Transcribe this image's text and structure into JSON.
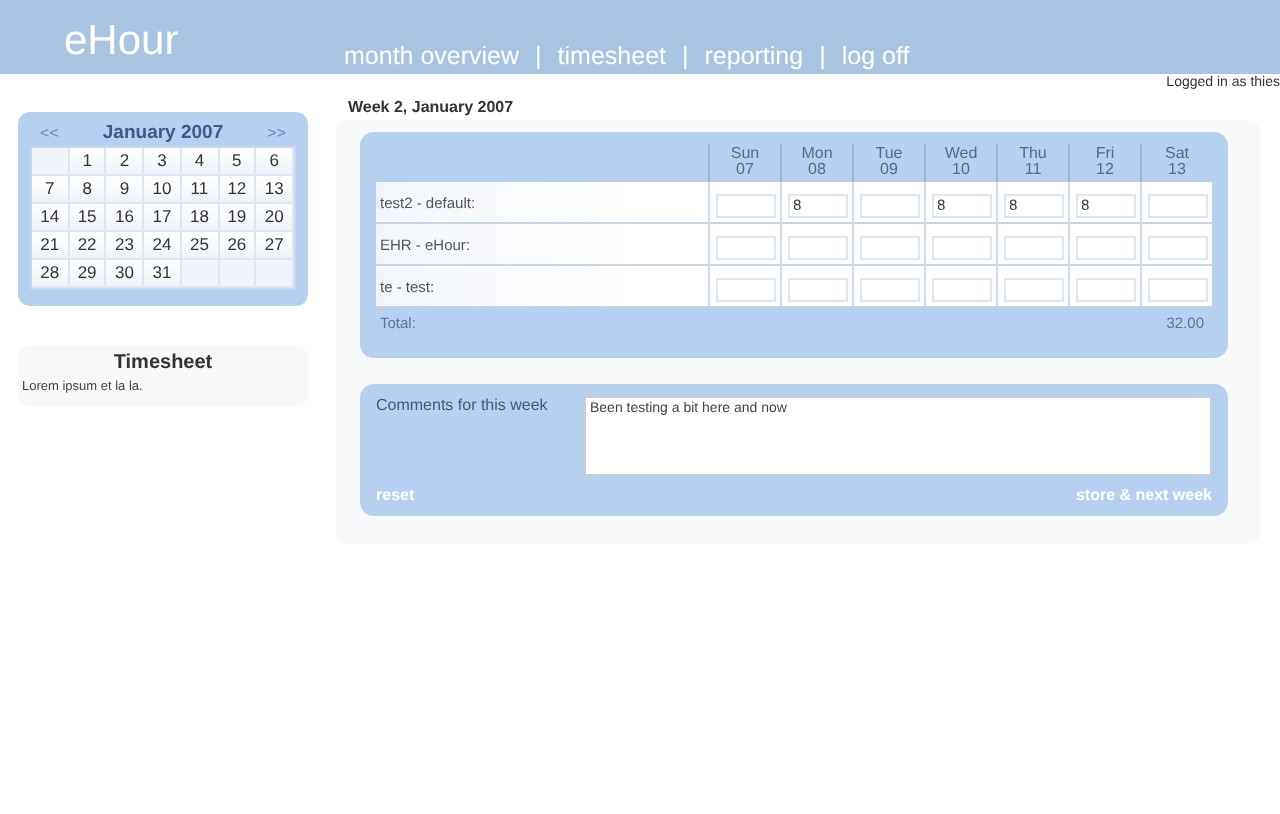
{
  "header": {
    "logo": "eHour",
    "nav": [
      {
        "label": "month overview"
      },
      {
        "label": "timesheet"
      },
      {
        "label": "reporting"
      },
      {
        "label": "log off"
      }
    ],
    "separator": "|",
    "logged_in": "Logged in as thies"
  },
  "calendar": {
    "prev": "<<",
    "title": "January 2007",
    "next": ">>",
    "weeks": [
      [
        {
          "kind": "blank"
        },
        {
          "kind": "day",
          "day": "1"
        },
        {
          "kind": "day",
          "day": "2"
        },
        {
          "kind": "day",
          "day": "3"
        },
        {
          "kind": "day",
          "day": "4"
        },
        {
          "kind": "day",
          "day": "5"
        },
        {
          "kind": "day",
          "day": "6"
        }
      ],
      [
        {
          "kind": "day",
          "day": "7"
        },
        {
          "kind": "day",
          "day": "8"
        },
        {
          "kind": "day",
          "day": "9"
        },
        {
          "kind": "day",
          "day": "10"
        },
        {
          "kind": "day",
          "day": "11"
        },
        {
          "kind": "day",
          "day": "12"
        },
        {
          "kind": "day",
          "day": "13"
        }
      ],
      [
        {
          "kind": "day",
          "day": "14"
        },
        {
          "kind": "day",
          "day": "15"
        },
        {
          "kind": "day",
          "day": "16"
        },
        {
          "kind": "day",
          "day": "17"
        },
        {
          "kind": "day",
          "day": "18"
        },
        {
          "kind": "day",
          "day": "19"
        },
        {
          "kind": "day",
          "day": "20"
        }
      ],
      [
        {
          "kind": "day",
          "day": "21"
        },
        {
          "kind": "day",
          "day": "22"
        },
        {
          "kind": "day",
          "day": "23"
        },
        {
          "kind": "day",
          "day": "24"
        },
        {
          "kind": "day",
          "day": "25"
        },
        {
          "kind": "day",
          "day": "26"
        },
        {
          "kind": "day",
          "day": "27"
        }
      ],
      [
        {
          "kind": "day",
          "day": "28"
        },
        {
          "kind": "day",
          "day": "29"
        },
        {
          "kind": "day",
          "day": "30"
        },
        {
          "kind": "day",
          "day": "31"
        },
        {
          "kind": "blank"
        },
        {
          "kind": "blank"
        },
        {
          "kind": "blank"
        }
      ]
    ]
  },
  "info": {
    "title": "Timesheet",
    "text": "Lorem ipsum et la la."
  },
  "week_title": "Week 2, January 2007",
  "timesheet": {
    "days": [
      {
        "name": "Sun",
        "date": "07"
      },
      {
        "name": "Mon",
        "date": "08"
      },
      {
        "name": "Tue",
        "date": "09"
      },
      {
        "name": "Wed",
        "date": "10"
      },
      {
        "name": "Thu",
        "date": "11"
      },
      {
        "name": "Fri",
        "date": "12"
      },
      {
        "name": "Sat",
        "date": "13"
      }
    ],
    "rows": [
      {
        "project": "test2 - default:",
        "hours": [
          {
            "kind": "empty"
          },
          {
            "kind": "filled",
            "value": "8"
          },
          {
            "kind": "empty"
          },
          {
            "kind": "filled",
            "value": "8"
          },
          {
            "kind": "filled",
            "value": "8"
          },
          {
            "kind": "filled",
            "value": "8"
          },
          {
            "kind": "empty"
          }
        ]
      },
      {
        "project": "EHR - eHour:",
        "hours": [
          {
            "kind": "empty"
          },
          {
            "kind": "empty"
          },
          {
            "kind": "empty"
          },
          {
            "kind": "empty"
          },
          {
            "kind": "empty"
          },
          {
            "kind": "empty"
          },
          {
            "kind": "empty"
          }
        ]
      },
      {
        "project": "te - test:",
        "hours": [
          {
            "kind": "empty"
          },
          {
            "kind": "empty"
          },
          {
            "kind": "empty"
          },
          {
            "kind": "empty"
          },
          {
            "kind": "empty"
          },
          {
            "kind": "empty"
          },
          {
            "kind": "empty"
          }
        ]
      }
    ],
    "total_label": "Total:",
    "total": "32.00"
  },
  "comments": {
    "label": "Comments for this week",
    "value": "Been testing a bit here and now",
    "reset": "reset",
    "submit": "store & next week"
  }
}
